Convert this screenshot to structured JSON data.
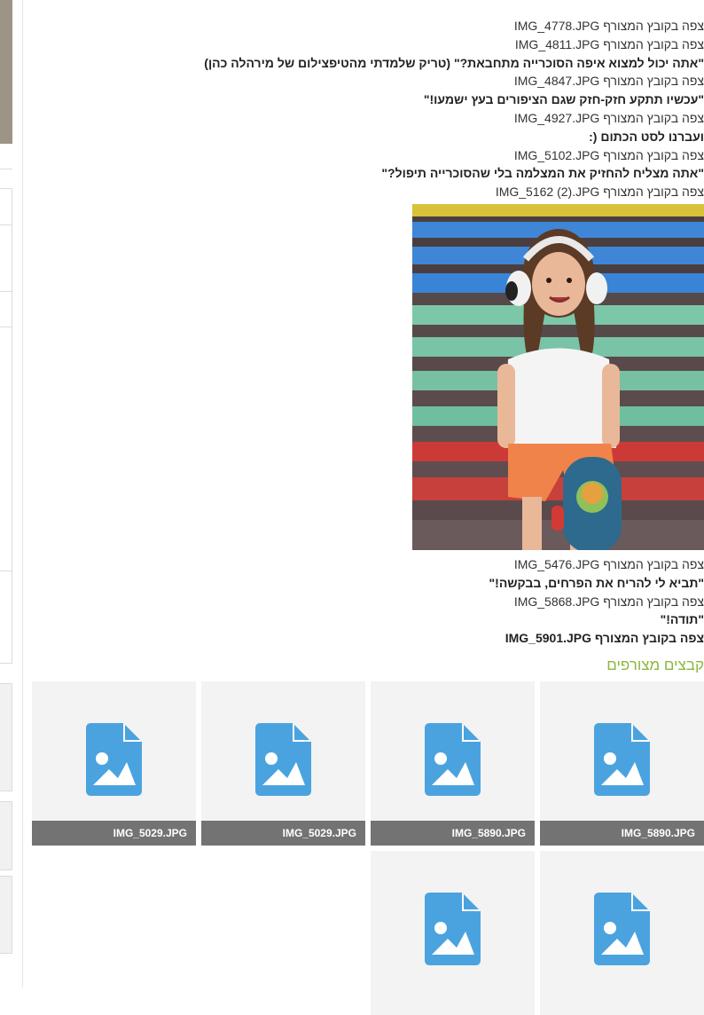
{
  "body_lines": [
    {
      "kind": "att",
      "prefix": "צפה בקובץ המצורף",
      "file": "IMG_4778.JPG"
    },
    {
      "kind": "att",
      "prefix": "צפה בקובץ המצורף",
      "file": "IMG_4811.JPG"
    },
    {
      "kind": "cap",
      "text": "\"אתה יכול למצוא איפה הסוכרייה מתחבאת?\" (טריק שלמדתי מהטיפצילום של מירהלה כהן)"
    },
    {
      "kind": "att",
      "prefix": "צפה בקובץ המצורף",
      "file": "IMG_4847.JPG"
    },
    {
      "kind": "cap",
      "text": "\"עכשיו תתקע חזק-חזק שגם הציפורים בעץ ישמעו!\""
    },
    {
      "kind": "att",
      "prefix": "צפה בקובץ המצורף",
      "file": "IMG_4927.JPG"
    },
    {
      "kind": "cap",
      "text": "ועברנו לסט הכתום (:"
    },
    {
      "kind": "att",
      "prefix": "צפה בקובץ המצורף",
      "file": "IMG_5102.JPG"
    },
    {
      "kind": "cap",
      "text": "\"אתה מצליח להחזיק את המצלמה בלי שהסוכרייה תיפול?\""
    },
    {
      "kind": "att",
      "prefix": "צפה בקובץ המצורף",
      "file": "IMG_5162 (2).JPG"
    }
  ],
  "after_lines": [
    {
      "kind": "att",
      "prefix": "צפה בקובץ המצורף",
      "file": "IMG_5476.JPG"
    },
    {
      "kind": "cap",
      "text": "\"תביא לי להריח את הפרחים, בבקשה!\""
    },
    {
      "kind": "att",
      "prefix": "צפה בקובץ המצורף",
      "file": "IMG_5868.JPG"
    },
    {
      "kind": "cap",
      "text": "\"תודה!\""
    },
    {
      "kind": "strong",
      "prefix": "צפה בקובץ המצורף",
      "file": "IMG_5901.JPG"
    }
  ],
  "attachments_title": "קבצים מצורפים",
  "attachments": [
    {
      "name": "IMG_5890.JPG"
    },
    {
      "name": "IMG_5890.JPG"
    },
    {
      "name": "IMG_5029.JPG"
    },
    {
      "name": "IMG_5029.JPG"
    },
    {
      "name": ""
    },
    {
      "name": ""
    }
  ],
  "colors": {
    "accent": "#8bb83a",
    "file_icon": "#4aa3df",
    "tile_bg": "#f3f3f3",
    "tile_bar": "#737373"
  }
}
